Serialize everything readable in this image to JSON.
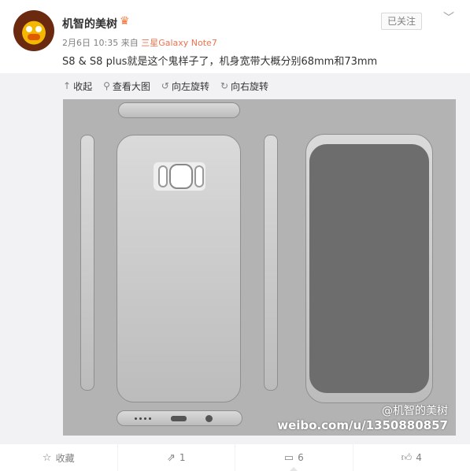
{
  "post": {
    "username": "机智的美树",
    "meta_time": "2月6日 10:35",
    "meta_from": "来自",
    "meta_device": "三星Galaxy Note7",
    "text": "S8 & S8 plus就是这个鬼样子了，机身宽带大概分别68mm和73mm",
    "follow_label": "已关注",
    "icons": {
      "vip": "vip-crown-icon",
      "more": "chevron-down-icon"
    }
  },
  "toolbar": {
    "collapse": "收起",
    "view_large": "查看大图",
    "rotate_left": "向左旋转",
    "rotate_right": "向右旋转"
  },
  "watermark": {
    "name": "@机智的美树",
    "url": "weibo.com/u/1350880857"
  },
  "footer": {
    "favorite_label": "收藏",
    "repost_count": "1",
    "comment_count": "6",
    "like_count": "4"
  },
  "colors": {
    "link": "#eb7350",
    "text": "#333333",
    "muted": "#808080",
    "media_bg": "#b3b3b3"
  }
}
